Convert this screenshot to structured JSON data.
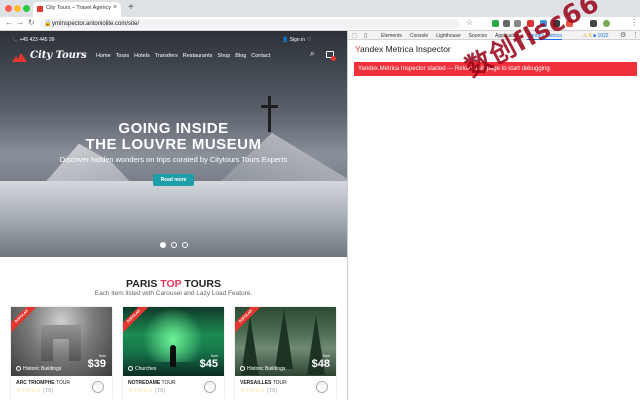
{
  "browser": {
    "tab_title": "City Tours – Travel Agency",
    "tab_close": "×",
    "new_tab": "+",
    "url": "ymInspector.antoniolite.com/site/",
    "back": "←",
    "forward": "→",
    "reload": "↻",
    "lock": "🔒",
    "star": "☆",
    "menu": "⋮"
  },
  "site": {
    "phone": "📞 +45 423 445 99",
    "signin": "👤 Sign in",
    "lang": "♡",
    "logo": "City Tours",
    "nav": [
      "Home",
      "Tours",
      "Hotels",
      "Transfers",
      "Restaurants",
      "Shop",
      "Blog",
      "Contact"
    ],
    "search_icon": "⌕",
    "hero": {
      "line1": "GOING INSIDE",
      "line2": "THE LOUVRE MUSEUM",
      "subtitle": "Discover hidden wonders on trips curated by Citytours Tours Experts",
      "button": "Read more"
    },
    "section": {
      "title_before": "PARIS ",
      "title_accent": "TOP",
      "title_after": " TOURS",
      "subtitle": "Each item listed with Carousel and Lazy Load Feature."
    },
    "cards": [
      {
        "ribbon": "POPULAR",
        "category": "Historic Buildings",
        "price_from": "from",
        "price": "$39",
        "name_bold": "ARC TRIOMPHE",
        "name_rest": " TOUR",
        "stars": "☆☆☆☆☆",
        "reviews": "(75)"
      },
      {
        "ribbon": "POPULAR",
        "category": "Churches",
        "price_from": "from",
        "price": "$45",
        "name_bold": "NOTREDAME",
        "name_rest": " TOUR",
        "stars": "☆☆☆☆☆",
        "reviews": "(75)"
      },
      {
        "ribbon": "POPULAR",
        "category": "Historic Buildings",
        "price_from": "from",
        "price": "$48",
        "name_bold": "VERSAILLES",
        "name_rest": " TOUR",
        "stars": "☆☆☆☆☆",
        "reviews": "(75)"
      }
    ],
    "heart": "♡"
  },
  "devtools": {
    "tabs": [
      "Elements",
      "Console",
      "Lighthouse",
      "Sources",
      "Application",
      "Yandex Metrica"
    ],
    "active_tab": "Yandex Metrica",
    "warnings": "⚠ 6",
    "messages": "■ 1022",
    "gear": "⚙",
    "more": "⋮",
    "inspector_title_first": "Y",
    "inspector_title_rest": "andex Metrica Inspector",
    "status_message": "Yandex.Metrica Inspector started — Reload this page to start debugging"
  },
  "watermark": "数创flsc66"
}
